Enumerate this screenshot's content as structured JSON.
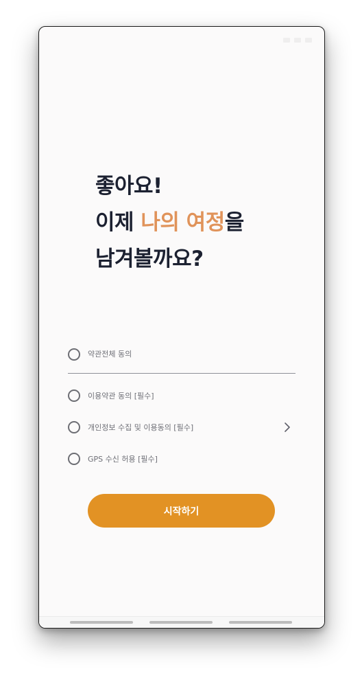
{
  "headline": {
    "line1": "좋아요!",
    "line2_before": "이제 ",
    "line2_accent": "나의 여정",
    "line2_after": "을",
    "line3": "남겨볼까요?"
  },
  "terms": {
    "all": "약관전체 동의",
    "items": [
      {
        "label": "이용약관 동의 [필수]",
        "has_chevron": false
      },
      {
        "label": "개인정보 수집 및 이용동의 [필수]",
        "has_chevron": true
      },
      {
        "label": "GPS 수신 허용 [필수]",
        "has_chevron": false
      }
    ]
  },
  "start_button": {
    "label": "시작하기"
  },
  "colors": {
    "accent": "#e0935a",
    "button": "#e29224",
    "headline": "#1c2131",
    "background": "#fbfafa"
  },
  "icons": [
    "radio-unchecked-icon",
    "chevron-right-icon"
  ]
}
